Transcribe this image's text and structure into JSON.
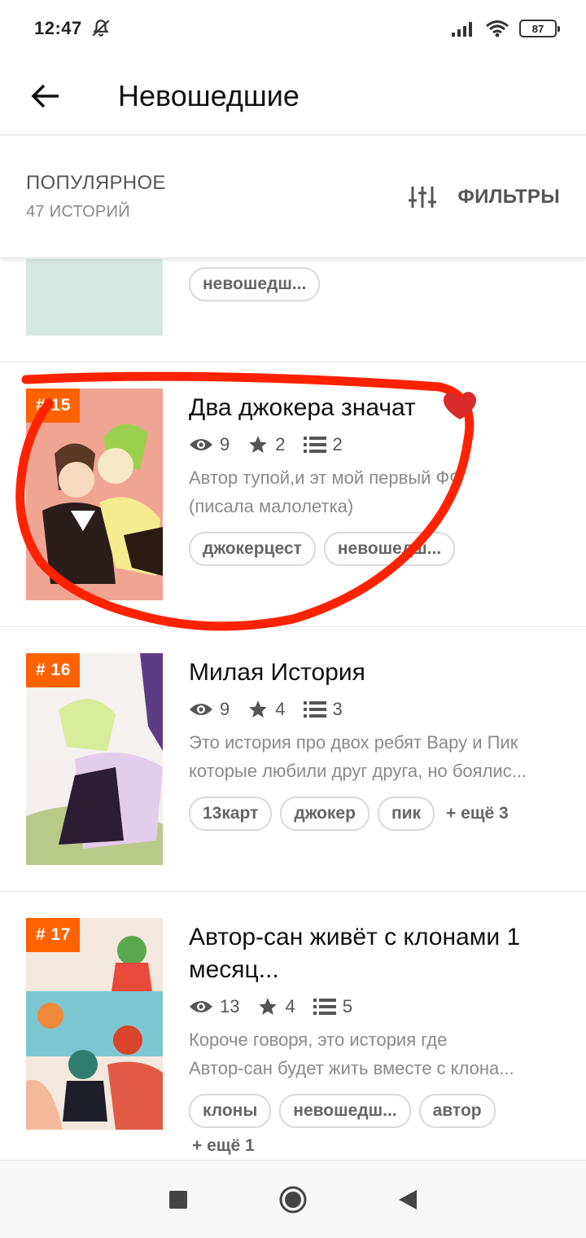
{
  "status_bar": {
    "time": "12:47",
    "battery": "87"
  },
  "header": {
    "title": "Невошедшие"
  },
  "sort": {
    "title": "ПОПУЛЯРНОЕ",
    "count": "47 ИСТОРИЙ",
    "filters_label": "ФИЛЬТРЫ"
  },
  "stories": [
    {
      "partial": true,
      "tags": [
        "невошедш..."
      ],
      "cover_color": "#d5e8e1"
    },
    {
      "rank": "# 15",
      "title": "Два джокера значат",
      "views": "9",
      "stars": "2",
      "chapters": "2",
      "desc1": "Автор тупой,и эт мой первый ФФ",
      "desc2": "(писала малолетка)",
      "tags": [
        "джокерцест",
        "невошедш..."
      ]
    },
    {
      "rank": "# 16",
      "title": "Милая История",
      "views": "9",
      "stars": "4",
      "chapters": "3",
      "desc1": "Это история про двох ребят Вару и Пик",
      "desc2": "которые любили друг друга, но боялис...",
      "tags": [
        "13карт",
        "джокер",
        "пик"
      ],
      "more": "+ ещё 3"
    },
    {
      "rank": "# 17",
      "title_line1": "Автор-сан живёт с клонами 1",
      "title_line2": "месяц...",
      "views": "13",
      "stars": "4",
      "chapters": "5",
      "desc1": "Короче говоря, это история где",
      "desc2": "Автор-сан будет жить вместе с клона...",
      "tags": [
        "клоны",
        "невошедш...",
        "автор"
      ],
      "more": "+ ещё 1"
    }
  ],
  "colors": {
    "accent": "#ff6200",
    "annotation": "#ff2200"
  }
}
